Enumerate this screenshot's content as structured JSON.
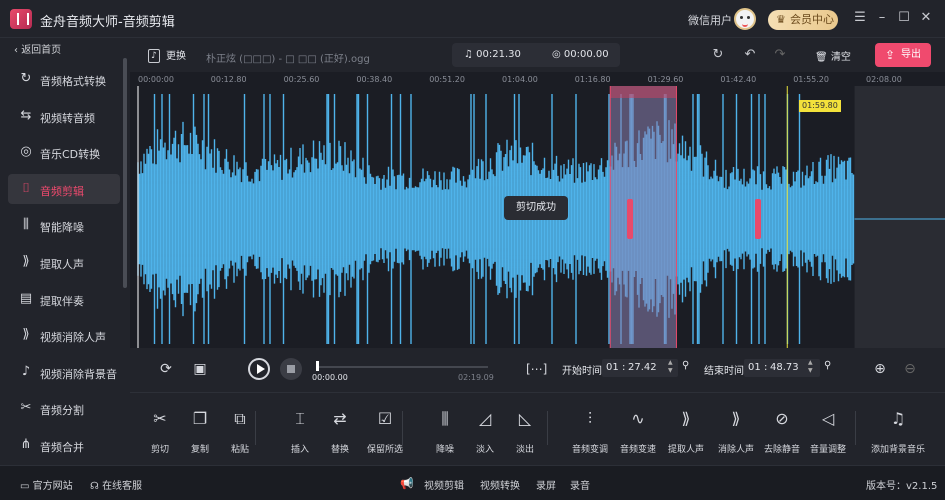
{
  "window": {
    "title": "金舟音频大师-音频剪辑",
    "user_label": "微信用户",
    "vip_label": "会员中心",
    "controls": [
      "menu-icon",
      "minimize-icon",
      "maximize-icon",
      "close-icon"
    ]
  },
  "sidebar": {
    "back_label": "返回首页",
    "items": [
      {
        "label": "音频格式转换",
        "icon": "convert-icon"
      },
      {
        "label": "视频转音频",
        "icon": "video-to-audio-icon"
      },
      {
        "label": "音乐CD转换",
        "icon": "cd-icon"
      },
      {
        "label": "音频剪辑",
        "icon": "clip-icon",
        "active": true
      },
      {
        "label": "智能降噪",
        "icon": "denoise-icon"
      },
      {
        "label": "提取人声",
        "icon": "extract-voice-icon"
      },
      {
        "label": "提取伴奏",
        "icon": "extract-accompaniment-icon"
      },
      {
        "label": "视频消除人声",
        "icon": "video-remove-voice-icon"
      },
      {
        "label": "视频消除背景音",
        "icon": "video-remove-bg-icon"
      },
      {
        "label": "音频分割",
        "icon": "split-icon"
      },
      {
        "label": "音频合并",
        "icon": "merge-icon"
      }
    ]
  },
  "topbar": {
    "change_label": "更换",
    "file_name": "朴正炫 (□□□) - □ □□ (正好).ogg",
    "total_time": "00:21.30",
    "selection_time": "00:00.00",
    "clear_label": "清空",
    "export_label": "导出"
  },
  "timeline": {
    "ticks": [
      "00:00:00",
      "00:12.80",
      "00:25.60",
      "00:38.40",
      "00:51.20",
      "01:04.00",
      "01:16.80",
      "01:29.60",
      "01:42.40",
      "01:55.20",
      "02:08.00"
    ],
    "cursor_label": "01:59.80",
    "toast": "剪切成功",
    "selection_start_fraction": 0.6133,
    "selection_end_fraction": 0.6993,
    "cursor_fraction": 0.8432,
    "played_until_fraction": 0.9306
  },
  "player": {
    "current_time": "00:00.00",
    "total_time": "02:19.09",
    "start_label": "开始时间",
    "start_min": "01",
    "start_sec": "27.42",
    "end_label": "结束时间",
    "end_min": "01",
    "end_sec": "48.73"
  },
  "tools": [
    {
      "label": "剪切",
      "icon": "scissors-icon"
    },
    {
      "label": "复制",
      "icon": "copy-icon"
    },
    {
      "label": "粘贴",
      "icon": "paste-icon"
    },
    {
      "label": "插入",
      "icon": "insert-icon"
    },
    {
      "label": "替换",
      "icon": "replace-icon"
    },
    {
      "label": "保留所选",
      "icon": "keep-selected-icon"
    },
    {
      "label": "降噪",
      "icon": "noise-reduction-icon"
    },
    {
      "label": "淡入",
      "icon": "fade-in-icon"
    },
    {
      "label": "淡出",
      "icon": "fade-out-icon"
    },
    {
      "label": "音频变调",
      "icon": "pitch-icon"
    },
    {
      "label": "音频变速",
      "icon": "speed-icon"
    },
    {
      "label": "提取人声",
      "icon": "extract-voice-icon"
    },
    {
      "label": "消除人声",
      "icon": "remove-voice-icon"
    },
    {
      "label": "去除静音",
      "icon": "remove-silence-icon"
    },
    {
      "label": "音量调整",
      "icon": "volume-icon"
    },
    {
      "label": "添加背景音乐",
      "icon": "bg-music-icon"
    }
  ],
  "status": {
    "website": "官方网站",
    "support": "在线客服",
    "links": [
      "视频剪辑",
      "视频转换",
      "录屏",
      "录音"
    ],
    "version": "版本号：v2.1.5"
  },
  "colors": {
    "accent": "#f04a6e",
    "wave": "#4fb3ea",
    "selection": "#6a9fd1",
    "background": "#1e2027"
  }
}
